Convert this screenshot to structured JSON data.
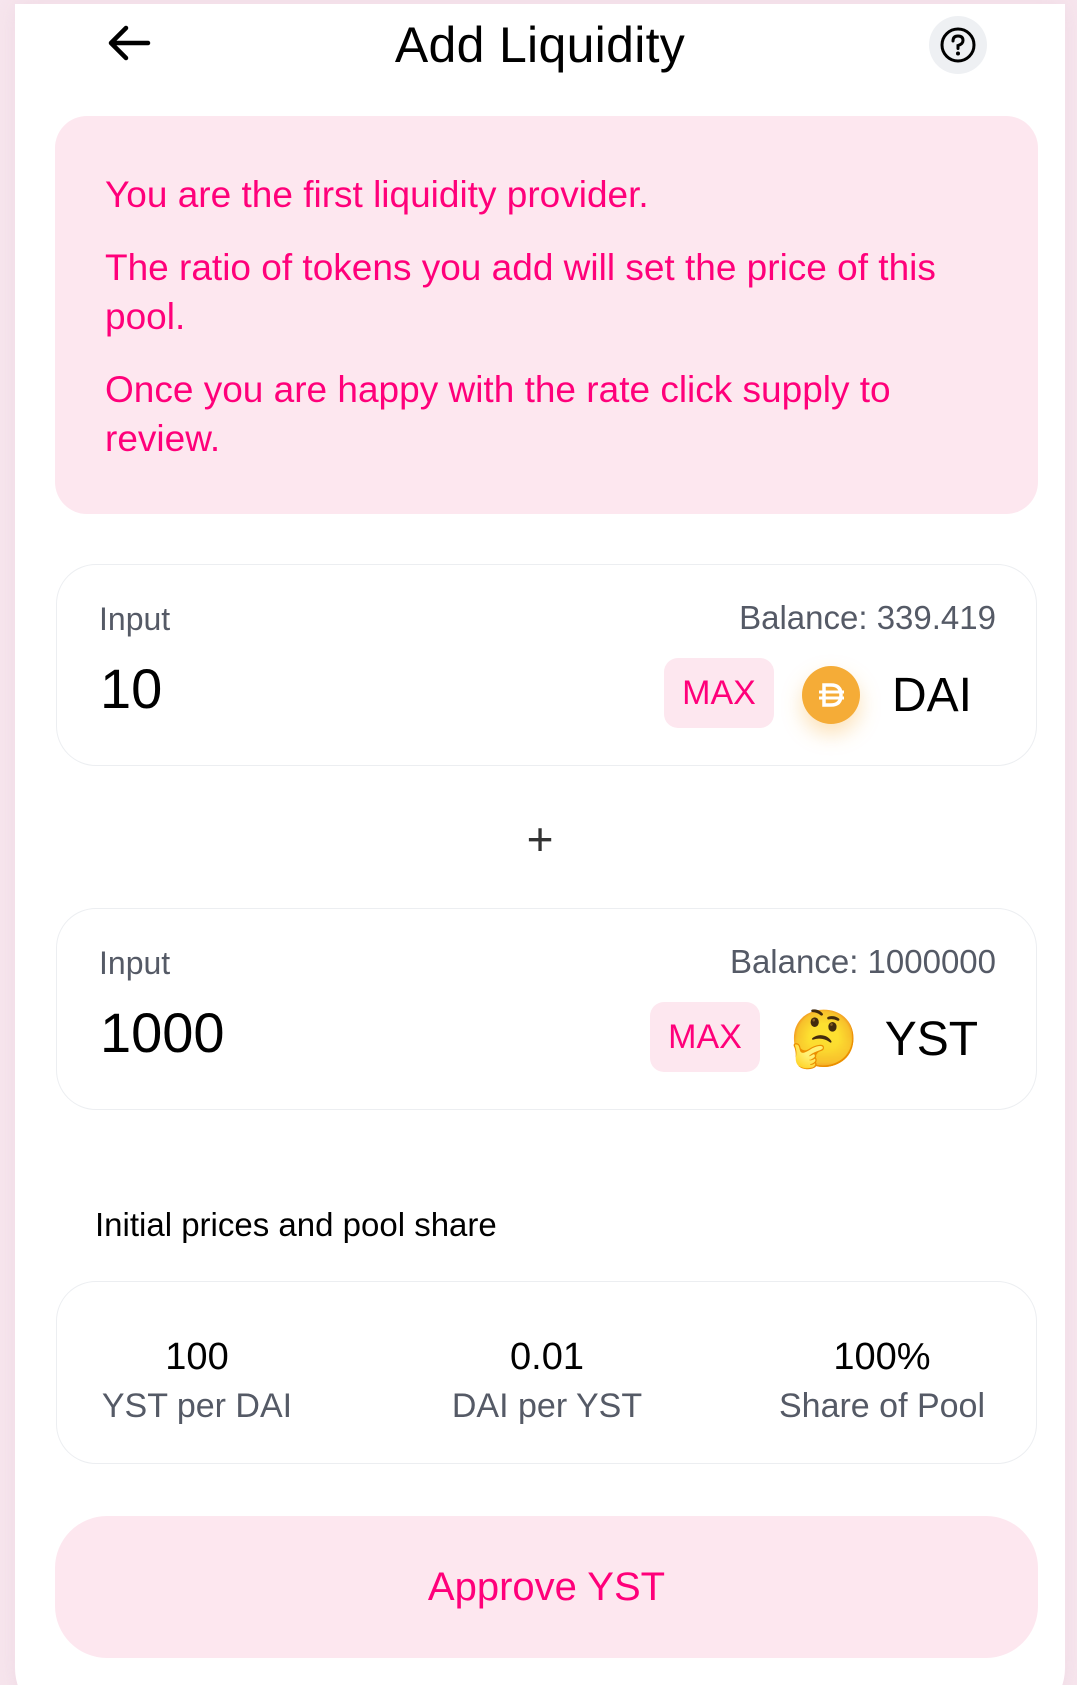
{
  "header": {
    "title": "Add Liquidity"
  },
  "notice": {
    "lines": [
      "You are the first liquidity provider.",
      "The ratio of tokens you add will set the price of this pool.",
      "Once you are happy with the rate click supply to review."
    ]
  },
  "inputs": [
    {
      "label": "Input",
      "balance": "Balance: 339.419",
      "value": "10",
      "max_label": "MAX",
      "token": "DAI",
      "icon": "dai-token-icon"
    },
    {
      "label": "Input",
      "balance": "Balance: 1000000",
      "value": "1000",
      "max_label": "MAX",
      "token": "YST",
      "icon": "thinking-face-emoji",
      "emoji": "🤔"
    }
  ],
  "plus_sign": "+",
  "prices": {
    "title": "Initial prices and pool share",
    "items": [
      {
        "value": "100",
        "label": "YST per DAI"
      },
      {
        "value": "0.01",
        "label": "DAI per YST"
      },
      {
        "value": "100%",
        "label": "Share of Pool"
      }
    ]
  },
  "approve_button": "Approve YST",
  "colors": {
    "accent": "#ff007a",
    "accent_bg": "#fde7ef",
    "dai": "#f5ac37"
  }
}
